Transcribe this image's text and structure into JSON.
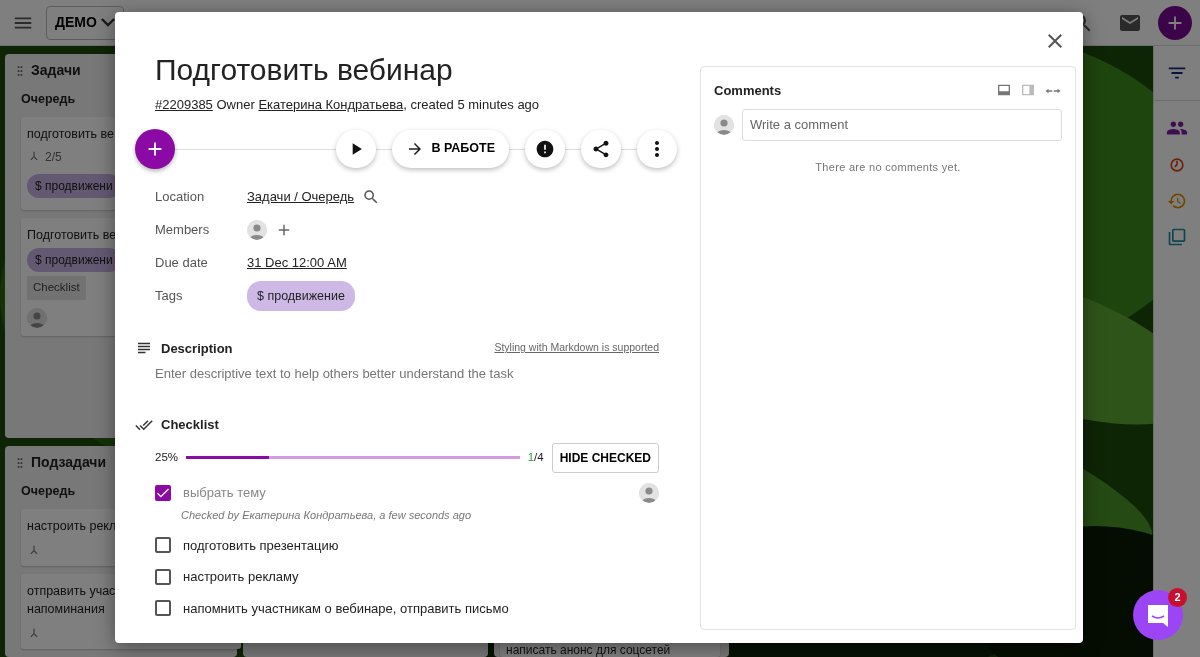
{
  "top_bar": {
    "board_button": "ДЕМО"
  },
  "board": {
    "lists": [
      {
        "title": "Задачи",
        "column": "Очередь",
        "cards": [
          {
            "title": "подготовить ве",
            "subtasks": "2/5",
            "tag": "$ продвижени"
          },
          {
            "title": "Подготовить ве",
            "tag": "$ продвижени",
            "checklist": "Checklist",
            "avatar": true
          }
        ]
      },
      {
        "title": "Подзадачи",
        "column": "Очередь",
        "cards": [
          {
            "title": "настроить рекл",
            "subtask_icon": true
          },
          {
            "title": "отправить учас напоминания",
            "subtask_icon": true
          }
        ]
      }
    ],
    "bottom_card": {
      "title": "написать анонс для соцсетей"
    }
  },
  "task": {
    "title": "Подготовить вебинар",
    "number": "#2209385",
    "owner_label": "Owner",
    "owner": "Екатерина Кондратьева",
    "created": ", created 5 minutes ago",
    "status_button": "В РАБОТЕ",
    "fields": [
      {
        "label": "Location",
        "kind": "link",
        "value": "Задачи / Очередь"
      },
      {
        "label": "Members",
        "kind": "members"
      },
      {
        "label": "Due date",
        "kind": "link",
        "value": "31 Dec 12:00 AM"
      },
      {
        "label": "Tags",
        "kind": "tags",
        "tags": [
          "$ продвижение"
        ]
      }
    ],
    "description": {
      "title": "Description",
      "hint": "Styling with Markdown is supported",
      "placeholder": "Enter descriptive text to help others better understand the task"
    },
    "checklist": {
      "title": "Checklist",
      "percent": "25%",
      "level": 0.25,
      "done": "1",
      "rest": "/4",
      "hide_button": "HIDE CHECKED",
      "items": [
        {
          "text": "выбрать тему",
          "checked": true,
          "note": "Checked by Екатерина Кондратьева, a few seconds ago"
        },
        {
          "text": "подготовить презентацию",
          "checked": false
        },
        {
          "text": "настроить рекламу",
          "checked": false
        },
        {
          "text": "напомнить участникам о вебинаре, отправить письмо",
          "checked": false
        }
      ]
    }
  },
  "comments": {
    "title": "Comments",
    "placeholder": "Write a comment",
    "empty": "There are no comments yet."
  },
  "chat": {
    "badge": "2"
  }
}
